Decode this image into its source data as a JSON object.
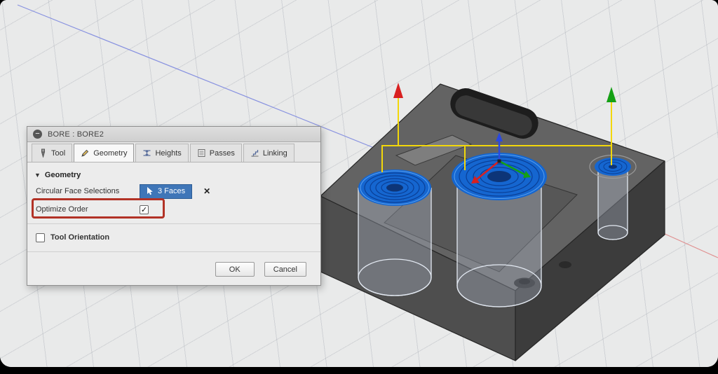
{
  "icons": {
    "collapse_minus": "−",
    "section_triangle": "▼",
    "deselect_x": "✕",
    "checkbox_check": "✓"
  },
  "colors": {
    "selection_chip_blue": "#3f76b8",
    "bore_highlight_blue": "#1566d0",
    "toolpath_yellow": "#f2d70a",
    "axis_x_red": "#d82020",
    "axis_y_green": "#14a014",
    "axis_z_blue": "#2a49e0",
    "annotation_red": "#b23226"
  },
  "dialog": {
    "title": "BORE : BORE2",
    "tabs": [
      {
        "id": "tool",
        "label": "Tool"
      },
      {
        "id": "geometry",
        "label": "Geometry"
      },
      {
        "id": "heights",
        "label": "Heights"
      },
      {
        "id": "passes",
        "label": "Passes"
      },
      {
        "id": "linking",
        "label": "Linking"
      }
    ],
    "geometry_section": {
      "header": "Geometry",
      "circular_face_selections_label": "Circular Face Selections",
      "faces_chip_label": "3 Faces",
      "optimize_order_label": "Optimize Order",
      "optimize_order_checked": true
    },
    "tool_orientation": {
      "label": "Tool Orientation",
      "checked": false
    },
    "footer": {
      "ok_label": "OK",
      "cancel_label": "Cancel"
    }
  }
}
